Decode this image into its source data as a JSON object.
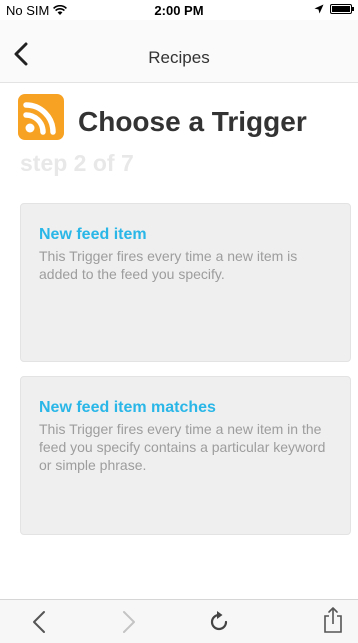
{
  "status_bar": {
    "carrier": "No SIM",
    "time": "2:00 PM",
    "icons": [
      "wifi-icon",
      "location-arrow-icon",
      "battery-icon"
    ]
  },
  "nav": {
    "title": "Recipes",
    "back_icon": "chevron-left-icon"
  },
  "header": {
    "channel_icon": "rss-feed-icon",
    "title": "Choose a Trigger",
    "step": "step 2 of 7"
  },
  "triggers": [
    {
      "title": "New feed item",
      "description": "This Trigger fires every time a new item is added to the feed you specify."
    },
    {
      "title": "New feed item matches",
      "description": "This Trigger fires every time a new item in the feed you specify contains a particular keyword or simple phrase."
    }
  ],
  "toolbar": {
    "icons": [
      "back-arrow-icon",
      "forward-arrow-icon",
      "reload-icon",
      "share-icon"
    ]
  },
  "colors": {
    "accent": "#2ab7e8",
    "rss_orange": "#f7a223",
    "card_bg": "#efefef",
    "step_text": "#e8e8e8"
  }
}
